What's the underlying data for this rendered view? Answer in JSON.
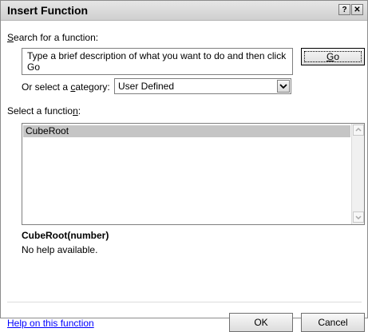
{
  "dialog": {
    "title": "Insert Function",
    "help_glyph": "?",
    "close_glyph": "✕"
  },
  "search": {
    "label_key": "S",
    "label_rest": "earch for a function:",
    "value": "Type a brief description of what you want to do and then click Go",
    "go_key": "G",
    "go_rest": "o"
  },
  "category": {
    "label_pre": "Or select a ",
    "label_key": "c",
    "label_post": "ategory:",
    "selected": "User Defined",
    "dropdown_glyph": "⌄"
  },
  "functions": {
    "label_pre": "Select a functio",
    "label_key": "n",
    "label_post": ":",
    "items": [
      "CubeRoot"
    ],
    "selected": "CubeRoot",
    "scroll_up_glyph": "⌃",
    "scroll_down_glyph": "⌄"
  },
  "detail": {
    "signature": "CubeRoot(number)",
    "description": "No help available."
  },
  "footer": {
    "help_link": "Help on this function",
    "ok_label": "OK",
    "cancel_label": "Cancel"
  }
}
